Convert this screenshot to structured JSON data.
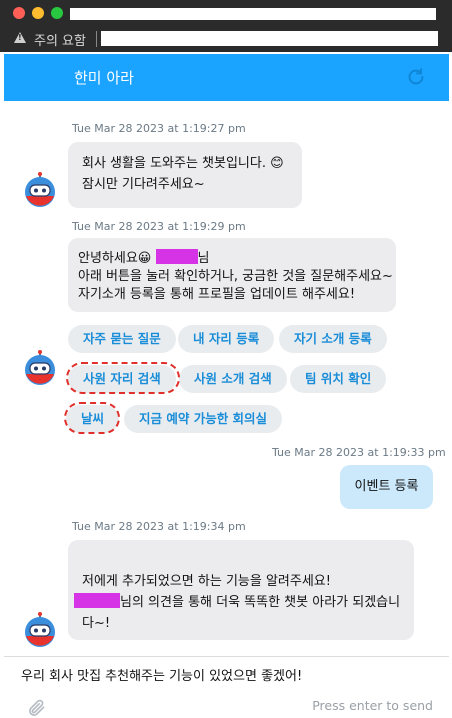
{
  "browser": {
    "warning_label": "주의 요함"
  },
  "header": {
    "title": "한미 아라",
    "refresh_icon": "refresh-icon"
  },
  "messages": [
    {
      "timestamp": "Tue Mar 28 2023 at 1:19:27 pm",
      "lines": [
        "회사 생활을 도와주는 챗봇입니다. 😊",
        "잠시만 기다려주세요~"
      ]
    },
    {
      "timestamp": "Tue Mar 28 2023 at 1:19:29 pm",
      "greeting_prefix": "안녕하세요😀 ",
      "greeting_suffix": "님",
      "lines": [
        "아래 버튼을 눌러 확인하거나, 궁금한 것을 질문해주세요~",
        "자기소개 등록을 통해 프로필을 업데이트 해주세요!"
      ],
      "chips": [
        "자주 묻는 질문",
        "내 자리 등록",
        "자기 소개 등록",
        "사원 자리 검색",
        "사원 소개 검색",
        "팀 위치 확인",
        "날씨",
        "지금 예약 가능한 회의실"
      ]
    },
    {
      "timestamp": "Tue Mar 28 2023 at 1:19:33 pm",
      "user_text": "이벤트 등록"
    },
    {
      "timestamp": "Tue Mar 28 2023 at 1:19:34 pm",
      "line1": "저에게 추가되었으면 하는 기능을 알려주세요!",
      "line2_suffix": "님의 의견을 통해 더욱 똑똑한 챗봇 아라가 되겠습니",
      "line3": "다~!"
    }
  ],
  "input": {
    "value": "우리 회사 맛집 추천해주는 기능이 있었으면 좋겠어!",
    "hint": "Press enter to send"
  },
  "colors": {
    "header": "#1aa3ff",
    "chip_text": "#1a8dd8",
    "user_bubble": "#cbe9fb",
    "bot_bubble": "#ececef"
  }
}
